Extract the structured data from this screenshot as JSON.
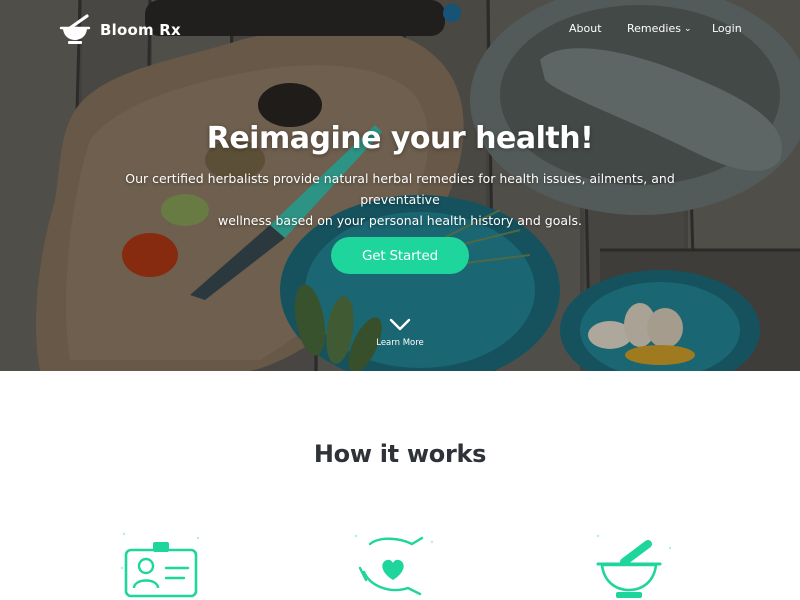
{
  "brand": {
    "name": "Bloom Rx",
    "accent": "#1ed59b"
  },
  "nav": {
    "items": [
      {
        "label": "About"
      },
      {
        "label": "Remedies",
        "has_dropdown": true
      },
      {
        "label": "Login"
      }
    ]
  },
  "hero": {
    "title": "Reimagine your health!",
    "subtitle_line1": "Our certified herbalists provide natural herbal remedies for health issues, ailments, and preventative",
    "subtitle_line2": "wellness based on your personal health history and goals.",
    "cta_label": "Get Started",
    "learn_more_label": "Learn More"
  },
  "how_it_works": {
    "title": "How it works",
    "steps": [
      {
        "icon": "id-card-icon"
      },
      {
        "icon": "hands-heart-icon"
      },
      {
        "icon": "mortar-pestle-icon"
      }
    ]
  }
}
